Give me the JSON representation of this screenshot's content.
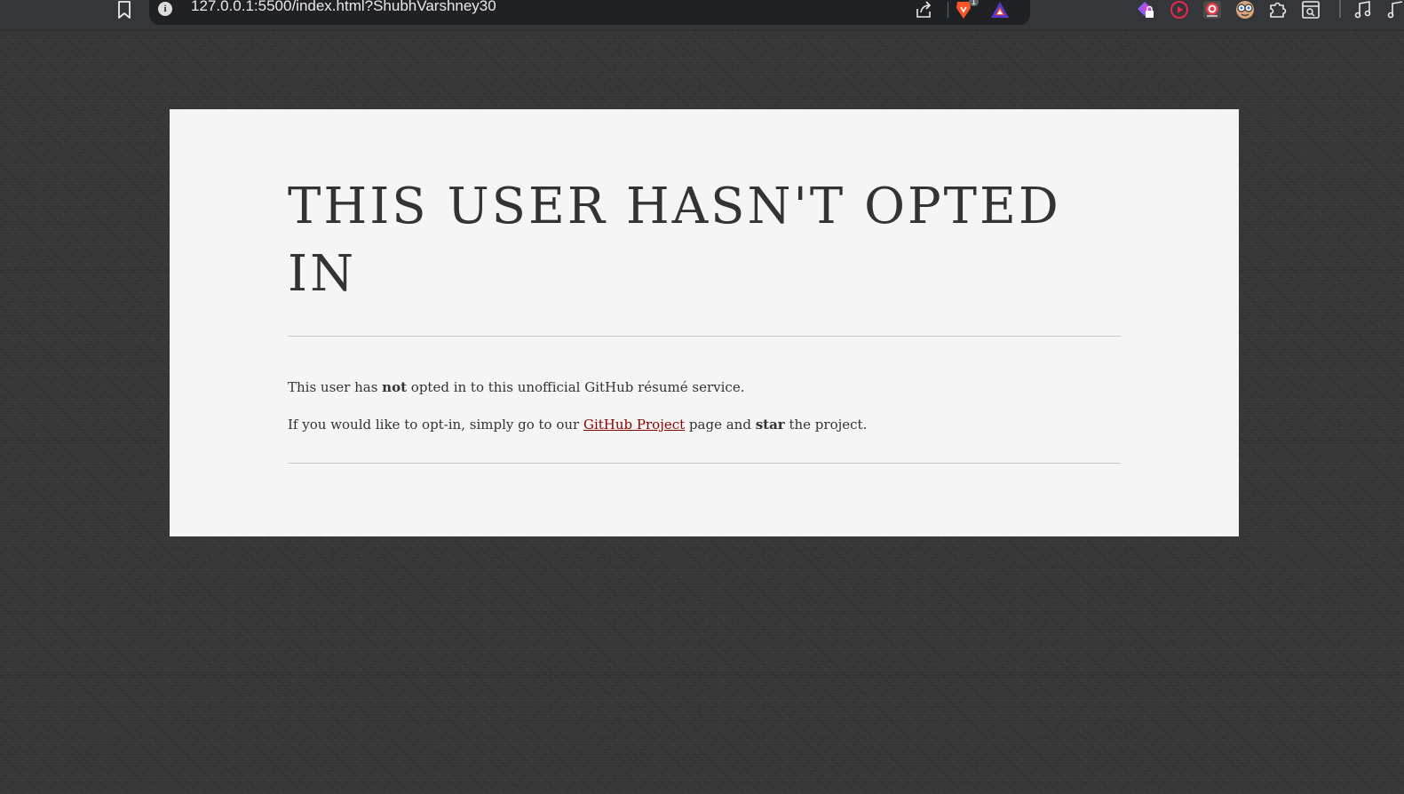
{
  "browser": {
    "url": "127.0.0.1:5500/index.html?ShubhVarshney30",
    "brave_badge_count": "1",
    "icons": {
      "bookmark": "bookmark-icon",
      "site_info": "info-icon",
      "share": "share-icon",
      "brave_shields": "brave-shields-icon",
      "brave_rewards": "brave-rewards-icon",
      "extensions": [
        "extension-lock-icon",
        "extension-play-icon",
        "extension-target-icon",
        "extension-glasses-icon",
        "puzzle-icon",
        "sidebar-search-icon",
        "music-icon"
      ]
    },
    "info_glyph": "i"
  },
  "page": {
    "heading": "THIS USER HASN'T OPTED IN",
    "para1": {
      "prefix": "This user has ",
      "bold": "not",
      "suffix": " opted in to this unofficial GitHub résumé service."
    },
    "para2": {
      "prefix": "If you would like to opt-in, simply go to our ",
      "link": "GitHub Project",
      "middle": " page and ",
      "bold": "star",
      "suffix": " the project."
    }
  },
  "colors": {
    "background": "#363636",
    "card": "#f5f5f5",
    "text": "#333333",
    "link": "#8b0000",
    "toolbar": "#35363a",
    "omnibox": "#202124"
  }
}
